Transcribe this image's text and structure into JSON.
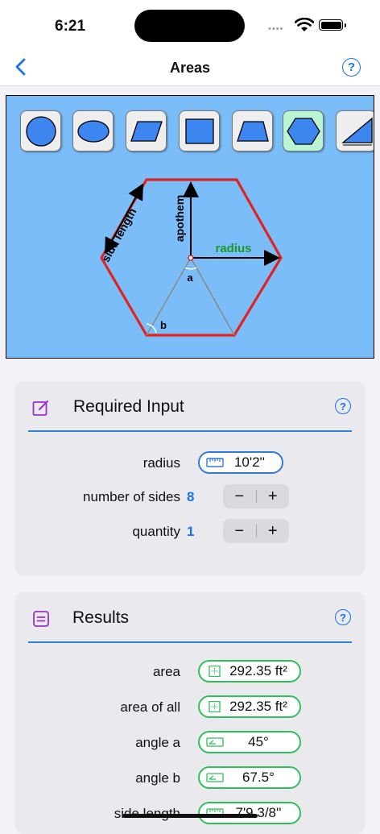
{
  "status": {
    "time": "6:21"
  },
  "nav": {
    "title": "Areas",
    "help": "?"
  },
  "shapes": [
    {
      "name": "circle",
      "selected": false
    },
    {
      "name": "ellipse",
      "selected": false
    },
    {
      "name": "parallelogram",
      "selected": false
    },
    {
      "name": "square",
      "selected": false
    },
    {
      "name": "trapezoid",
      "selected": false
    },
    {
      "name": "hexagon",
      "selected": true
    },
    {
      "name": "triangle",
      "selected": false
    }
  ],
  "diagram": {
    "side_label": "side length",
    "apothem_label": "apothem",
    "radius_label": "radius",
    "angle_a": "a",
    "angle_b": "b",
    "colors": {
      "outline": "#e0231f",
      "radius": "#1a9a25"
    }
  },
  "required": {
    "title": "Required Input",
    "help": "?",
    "rows": [
      {
        "label": "radius",
        "value": "10'2''"
      },
      {
        "label": "number of sides",
        "value": "8",
        "minus": "−",
        "plus": "+"
      },
      {
        "label": "quantity",
        "value": "1",
        "minus": "−",
        "plus": "+"
      }
    ]
  },
  "results": {
    "title": "Results",
    "help": "?",
    "rows": [
      {
        "label": "area",
        "value": "292.35 ft²"
      },
      {
        "label": "area of all",
        "value": "292.35 ft²"
      },
      {
        "label": "angle a",
        "value": "45°"
      },
      {
        "label": "angle b",
        "value": "67.5°"
      },
      {
        "label": "side length",
        "value": "7'9 3/8''"
      }
    ]
  }
}
